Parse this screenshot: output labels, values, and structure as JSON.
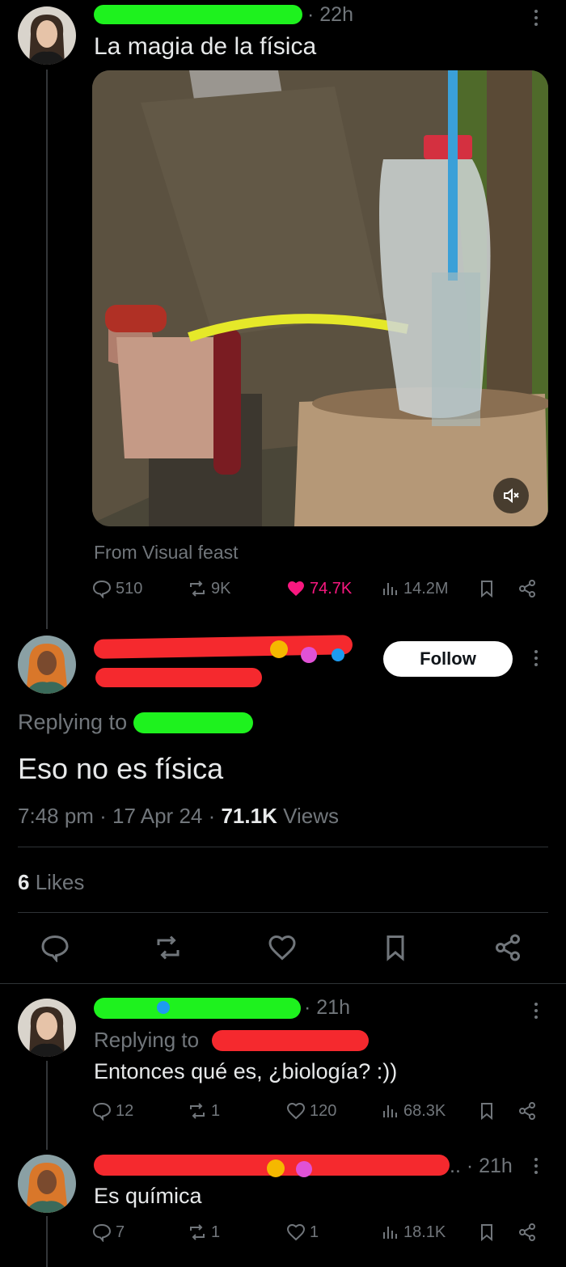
{
  "post1": {
    "time": "22h",
    "text": "La magia de la física",
    "source": "From Visual feast",
    "actions": {
      "replies": "510",
      "reposts": "9K",
      "likes": "74.7K",
      "views": "14.2M"
    }
  },
  "reply_focus": {
    "follow_label": "Follow",
    "replying_to_label": "Replying to",
    "text": "Eso no es física",
    "meta_time": "7:48 pm · 17 Apr 24 · ",
    "views_count": "71.1K",
    "views_label": " Views",
    "likes_count": "6",
    "likes_label": " Likes"
  },
  "reply2": {
    "time": "21h",
    "replying_to_label": "Replying to",
    "text": "Entonces qué es, ¿biología? :))",
    "actions": {
      "replies": "12",
      "reposts": "1",
      "likes": "120",
      "views": "68.3K"
    }
  },
  "reply3": {
    "time_suffix": ".. · 21h",
    "text": "Es química",
    "actions": {
      "replies": "7",
      "reposts": "1",
      "likes": "1",
      "views": "18.1K"
    }
  },
  "colors": {
    "like": "#f91880",
    "mention": "#1d9bf0",
    "muted": "#71767b"
  },
  "icons": [
    "reply-icon",
    "repost-icon",
    "heart-icon",
    "views-icon",
    "bookmark-icon",
    "share-icon",
    "mute-icon",
    "more-icon",
    "verified-icon"
  ]
}
